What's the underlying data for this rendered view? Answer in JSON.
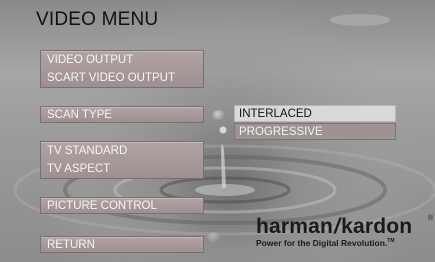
{
  "title": "VIDEO MENU",
  "menu": {
    "video_output": "VIDEO OUTPUT",
    "scart_video_output": "SCART VIDEO OUTPUT",
    "scan_type": "SCAN TYPE",
    "tv_standard": "TV STANDARD",
    "tv_aspect": "TV ASPECT",
    "picture_control": "PICTURE CONTROL",
    "return": "RETURN"
  },
  "scan_type_options": [
    "INTERLACED",
    "PROGRESSIVE"
  ],
  "brand": {
    "name_left": "harman",
    "separator": "/",
    "name_right": "kardon",
    "registered": "®",
    "tagline": "Power for the Digital Revolution.",
    "trademark": "TM"
  },
  "colors": {
    "button_fill": "#a89a9a",
    "option_highlight": "#d9d9d9",
    "option_normal": "#9e9393",
    "title_text": "#111111"
  },
  "icons": {
    "selection_indicator": "selection-bubble-icon"
  }
}
